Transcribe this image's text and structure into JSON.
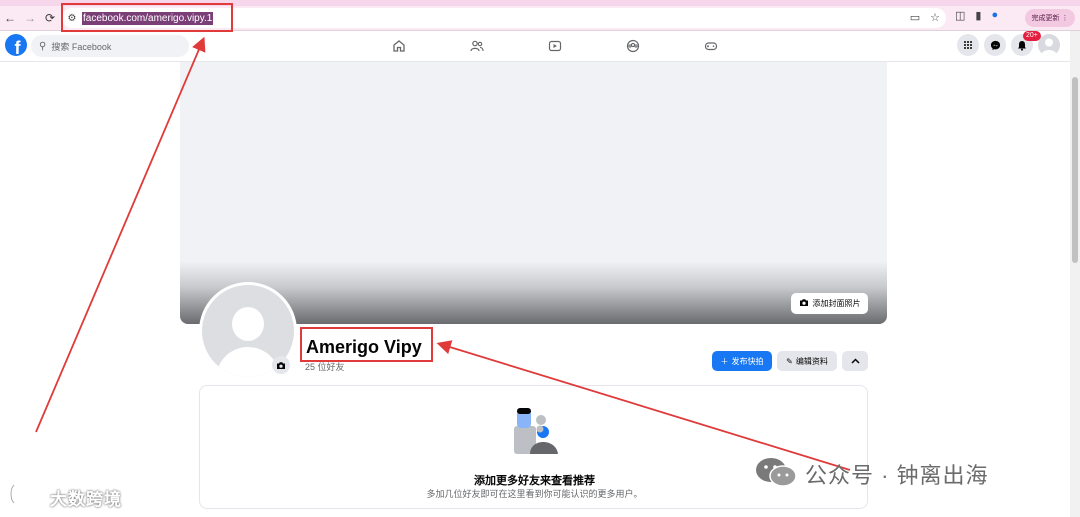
{
  "browser": {
    "url": "facebook.com/amerigo.vipy.1",
    "update_button": "完成更新"
  },
  "header": {
    "search_placeholder": "搜索 Facebook",
    "notification_badge": "20+"
  },
  "profile": {
    "name": "Amerigo Vipy",
    "friends": "25 位好友",
    "add_cover_label": "添加封面照片",
    "add_story_label": "发布快拍",
    "edit_profile_label": "编辑资料"
  },
  "suggestions": {
    "title": "添加更多好友来查看推荐",
    "subtitle": "多加几位好友即可在这里看到你可能认识的更多用户。"
  },
  "watermarks": {
    "right": "公众号 · 钟离出海",
    "left": "大数跨境"
  },
  "colors": {
    "fb_blue": "#1877f2",
    "annotation_red": "#e03a3a"
  }
}
